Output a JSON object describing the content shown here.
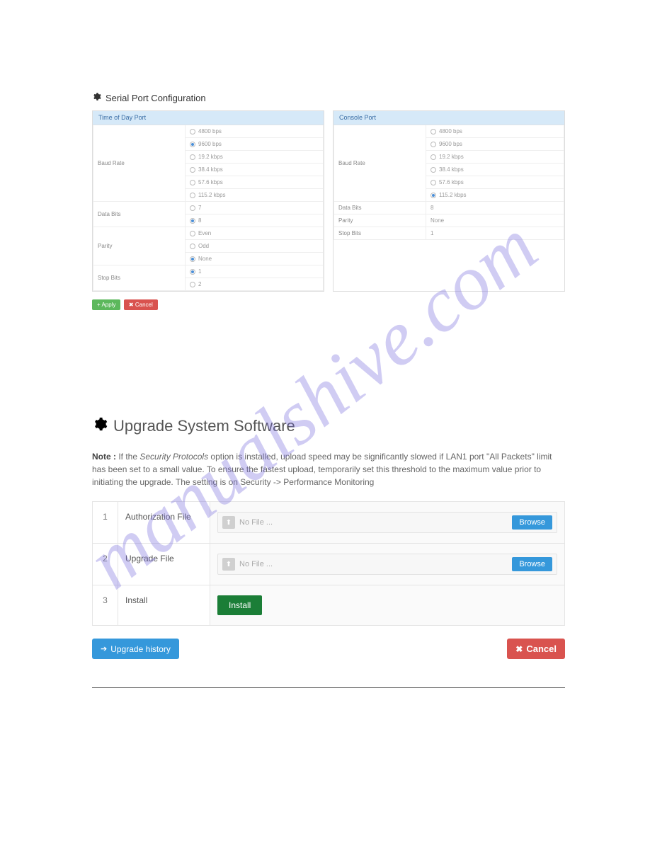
{
  "watermark": "manualshive.com",
  "serial": {
    "title": "Serial Port Configuration",
    "timeOfDay": {
      "header": "Time of Day Port",
      "baud_label": "Baud Rate",
      "baud_options": [
        "4800 bps",
        "9600 bps",
        "19.2 kbps",
        "38.4 kbps",
        "57.6 kbps",
        "115.2 kbps"
      ],
      "baud_selected": "9600 bps",
      "databits_label": "Data Bits",
      "databits_options": [
        "7",
        "8"
      ],
      "databits_selected": "8",
      "parity_label": "Parity",
      "parity_options": [
        "Even",
        "Odd",
        "None"
      ],
      "parity_selected": "None",
      "stopbits_label": "Stop Bits",
      "stopbits_options": [
        "1",
        "2"
      ],
      "stopbits_selected": "1"
    },
    "console": {
      "header": "Console Port",
      "baud_label": "Baud Rate",
      "baud_options": [
        "4800 bps",
        "9600 bps",
        "19.2 kbps",
        "38.4 kbps",
        "57.6 kbps",
        "115.2 kbps"
      ],
      "baud_selected": "115.2 kbps",
      "databits_label": "Data Bits",
      "databits_value": "8",
      "parity_label": "Parity",
      "parity_value": "None",
      "stopbits_label": "Stop Bits",
      "stopbits_value": "1"
    },
    "apply": "Apply",
    "cancel": "Cancel"
  },
  "upgrade": {
    "title": "Upgrade System Software",
    "note_label": "Note :",
    "note_emph": "Security Protocols",
    "note_before": " If the ",
    "note_after": " option is installed, upload speed may be significantly slowed if LAN1 port \"All Packets\" limit has been set to a small value. To ensure the fastest upload, temporarily set this threshold to the maximum value prior to initiating the upgrade. The setting is on Security -> Performance Monitoring",
    "steps": [
      {
        "n": "1",
        "label": "Authorization File",
        "placeholder": "No File ...",
        "browse": "Browse"
      },
      {
        "n": "2",
        "label": "Upgrade File",
        "placeholder": "No File ...",
        "browse": "Browse"
      },
      {
        "n": "3",
        "label": "Install",
        "install": "Install"
      }
    ],
    "history": "Upgrade history",
    "cancel": "Cancel"
  }
}
